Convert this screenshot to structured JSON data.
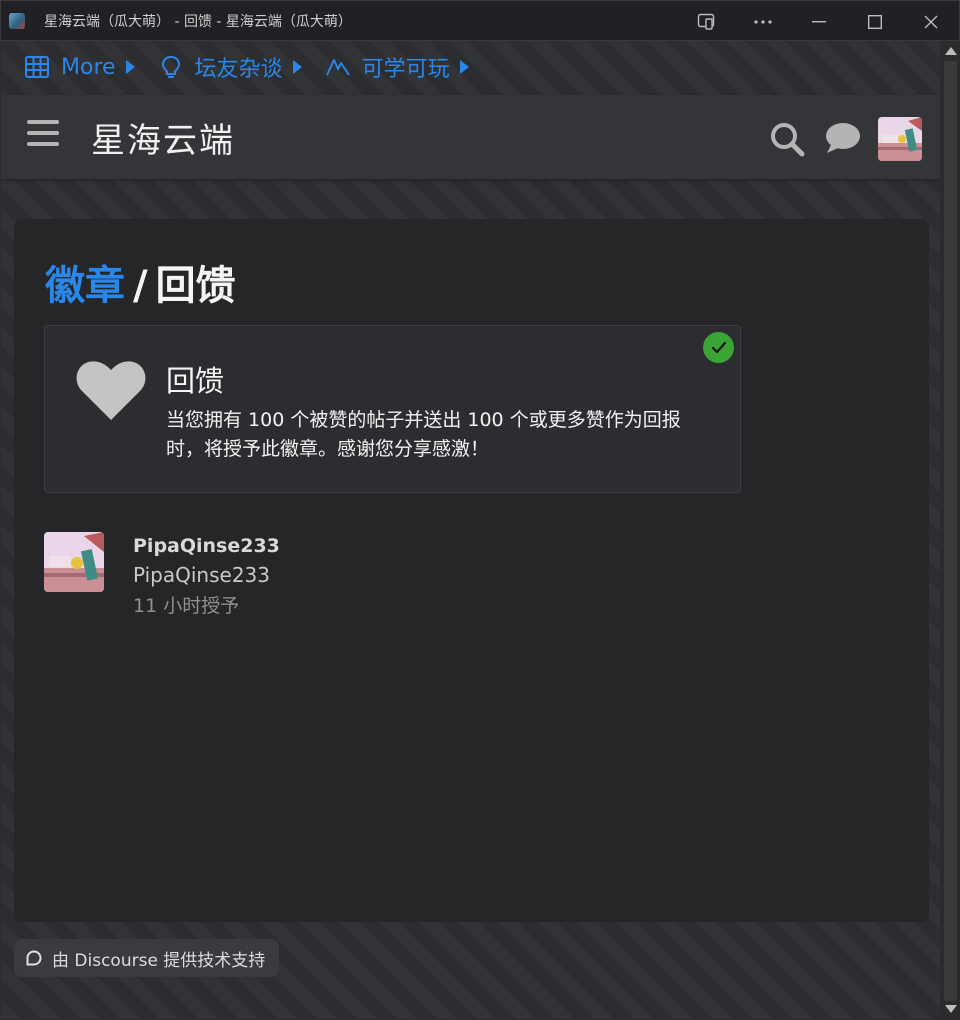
{
  "window": {
    "title": "星海云端（瓜大萌） - 回馈 - 星海云端（瓜大萌）"
  },
  "custom_nav": {
    "items": [
      {
        "label": "More",
        "icon": "grid-icon"
      },
      {
        "label": "坛友杂谈",
        "icon": "lightbulb-icon"
      },
      {
        "label": "可学可玩",
        "icon": "zigzag-icon"
      }
    ]
  },
  "header": {
    "logo_text": "星海云端",
    "icons": [
      "hamburger-menu-icon",
      "search-icon",
      "chat-icon",
      "user-avatar"
    ]
  },
  "page": {
    "breadcrumb_parent": "徽章",
    "separator": "/",
    "title": "回馈"
  },
  "badge": {
    "name": "回馈",
    "description": "当您拥有 100 个被赞的帖子并送出 100 个或更多赞作为回报时，将授予此徽章。感谢您分享感激！",
    "icon": "heart-icon",
    "granted": true
  },
  "grantee": {
    "username": "PipaQinse233",
    "display_name": "PipaQinse233",
    "granted_ago": "11 小时授予"
  },
  "footer": {
    "powered_by": "由 Discourse 提供技术支持"
  },
  "colors": {
    "accent": "#2a86e8",
    "success": "#3aa535",
    "background": "#2e2f32",
    "card": "#252628"
  }
}
